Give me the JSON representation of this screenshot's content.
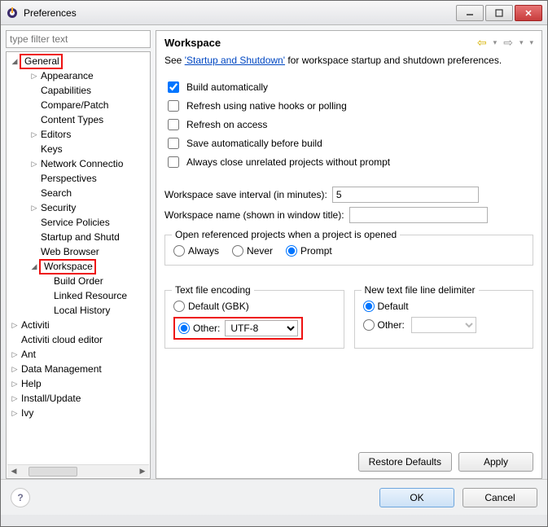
{
  "window": {
    "title": "Preferences"
  },
  "filter": {
    "placeholder": "type filter text"
  },
  "tree": {
    "general": {
      "label": "General",
      "children": {
        "appearance": "Appearance",
        "capabilities": "Capabilities",
        "compare": "Compare/Patch",
        "content": "Content Types",
        "editors": "Editors",
        "keys": "Keys",
        "network": "Network Connectio",
        "perspectives": "Perspectives",
        "search": "Search",
        "security": "Security",
        "service": "Service Policies",
        "startup": "Startup and Shutd",
        "webbrowser": "Web Browser",
        "workspace": {
          "label": "Workspace",
          "children": {
            "build": "Build Order",
            "linked": "Linked Resource",
            "local": "Local History"
          }
        }
      }
    },
    "activiti": "Activiti",
    "activiti_cloud": "Activiti cloud editor",
    "ant": "Ant",
    "datamgmt": "Data Management",
    "help": "Help",
    "install": "Install/Update",
    "ivy": "Ivy"
  },
  "page": {
    "title": "Workspace",
    "desc_pre": "See ",
    "desc_link": "'Startup and Shutdown'",
    "desc_post": " for workspace startup and shutdown preferences.",
    "checks": {
      "build_auto": {
        "label": "Build automatically",
        "checked": true
      },
      "refresh_native": {
        "label": "Refresh using native hooks or polling",
        "checked": false
      },
      "refresh_access": {
        "label": "Refresh on access",
        "checked": false
      },
      "save_before": {
        "label": "Save automatically before build",
        "checked": false
      },
      "close_unrelated": {
        "label": "Always close unrelated projects without prompt",
        "checked": false
      }
    },
    "save_interval_label": "Workspace save interval (in minutes):",
    "save_interval_value": "5",
    "ws_name_label": "Workspace name (shown in window title):",
    "ws_name_value": "",
    "open_ref_legend": "Open referenced projects when a project is opened",
    "open_ref": {
      "always": "Always",
      "never": "Never",
      "prompt": "Prompt"
    },
    "encoding": {
      "legend": "Text file encoding",
      "default_label": "Default (GBK)",
      "other_label": "Other:",
      "other_value": "UTF-8"
    },
    "delimiter": {
      "legend": "New text file line delimiter",
      "default_label": "Default",
      "other_label": "Other:"
    },
    "buttons": {
      "restore": "Restore Defaults",
      "apply": "Apply"
    }
  },
  "dialog": {
    "ok": "OK",
    "cancel": "Cancel"
  }
}
